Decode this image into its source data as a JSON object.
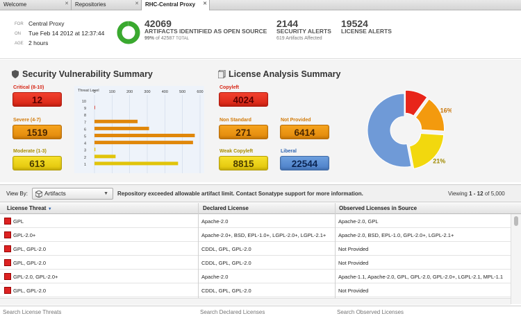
{
  "tabs": [
    {
      "label": "Welcome"
    },
    {
      "label": "Repositories"
    },
    {
      "label": "RHC-Central Proxy"
    }
  ],
  "header": {
    "for_label": "FOR",
    "for_value": "Central Proxy",
    "on_label": "ON",
    "on_value": "Tue Feb 14 2012 at 12:37:44",
    "age_label": "AGE",
    "age_value": "2 hours",
    "artifacts_count": "42069",
    "artifacts_caption": "ARTIFACTS IDENTIFIED AS OPEN SOURCE",
    "artifacts_pct": "99%",
    "artifacts_total": "of 42587",
    "artifacts_total_label": "TOTAL",
    "open_source_fraction": 0.99,
    "security_count": "2144",
    "security_caption": "SECURITY ALERTS",
    "security_sub": "619 Artifacts Affected",
    "license_count": "19524",
    "license_caption": "LICENSE ALERTS"
  },
  "security": {
    "title": "Security Vulnerability Summary",
    "levels": [
      {
        "label": "Critical (8-10)",
        "value": "12",
        "color": "#d62414"
      },
      {
        "label": "Severe (4-7)",
        "value": "1519",
        "color": "#e0870a"
      },
      {
        "label": "Moderate (1-3)",
        "value": "613",
        "color": "#c2a000"
      }
    ]
  },
  "chart_data": {
    "type": "bar",
    "orientation": "horizontal",
    "ylabel": "Threat Level",
    "categories": [
      "10",
      "9",
      "8",
      "7",
      "6",
      "5",
      "4",
      "3",
      "2",
      "1"
    ],
    "values": [
      0,
      3,
      0,
      245,
      310,
      570,
      560,
      5,
      120,
      475
    ],
    "bar_colors": [
      "#d62414",
      "#d62414",
      "#d62414",
      "#e0870a",
      "#e0870a",
      "#e0870a",
      "#e0870a",
      "#e1c40a",
      "#e1c40a",
      "#e1c40a"
    ],
    "xticks": [
      "0",
      "100",
      "200",
      "300",
      "400",
      "500",
      "600"
    ],
    "xlim": [
      0,
      600
    ],
    "grid": true
  },
  "license": {
    "title": "License Analysis Summary",
    "items": [
      {
        "label": "Copyleft",
        "value": "4024",
        "color": "#d62414"
      },
      {
        "label": "Non Standard",
        "value": "271",
        "color": "#e0870a"
      },
      {
        "label": "Not Provided",
        "value": "6414",
        "color": "#e0870a"
      },
      {
        "label": "Weak Copyleft",
        "value": "8815",
        "color": "#c2a000"
      },
      {
        "label": "Liberal",
        "value": "22544",
        "color": "#2d63b0"
      }
    ],
    "donut": [
      {
        "label": "10%",
        "value": 10,
        "color": "#e8251a"
      },
      {
        "label": "16%",
        "value": 16,
        "color": "#f39a0e"
      },
      {
        "label": "21%",
        "value": 21,
        "color": "#f2d80e"
      },
      {
        "label": "",
        "value": 53,
        "color": "#6f9ad7"
      }
    ]
  },
  "viewbar": {
    "view_by_label": "View By:",
    "dropdown_value": "Artifacts",
    "message": "Repository exceeded allowable artifact limit. Contact Sonatype support for more information.",
    "viewing_prefix": "Viewing",
    "viewing_range": "1 - 12",
    "viewing_suffix": "of 5,000"
  },
  "table": {
    "columns": [
      "License Threat",
      "Declared License",
      "Observed Licenses in Source"
    ],
    "rows": [
      {
        "threat": "GPL",
        "declared": "Apache-2.0",
        "observed": "Apache-2.0, GPL"
      },
      {
        "threat": "GPL-2.0+",
        "declared": "Apache-2.0+, BSD, EPL-1.0+, LGPL-2.0+, LGPL-2.1+",
        "observed": "Apache-2.0, BSD, EPL-1.0, GPL-2.0+, LGPL-2.1+"
      },
      {
        "threat": "GPL, GPL-2.0",
        "declared": "CDDL, GPL, GPL-2.0",
        "observed": "Not Provided"
      },
      {
        "threat": "GPL, GPL-2.0",
        "declared": "CDDL, GPL, GPL-2.0",
        "observed": "Not Provided"
      },
      {
        "threat": "GPL-2.0, GPL-2.0+",
        "declared": "Apache-2.0",
        "observed": "Apache-1.1, Apache-2.0, GPL, GPL-2.0, GPL-2.0+, LGPL-2.1, MPL-1.1"
      },
      {
        "threat": "GPL, GPL-2.0",
        "declared": "CDDL, GPL, GPL-2.0",
        "observed": "Not Provided"
      }
    ],
    "search_placeholders": [
      "Search License Threats",
      "Search Declared Licenses",
      "Search Observed Licenses"
    ]
  }
}
